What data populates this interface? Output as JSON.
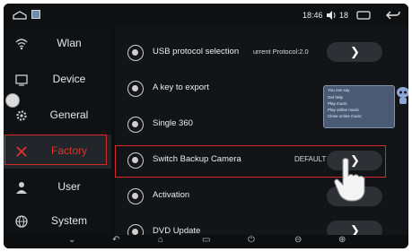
{
  "statusbar": {
    "time": "18:46",
    "volume_level": "18"
  },
  "sidebar": {
    "items": [
      {
        "label": "Wlan",
        "icon": "wifi-icon"
      },
      {
        "label": "Device",
        "icon": "device-icon"
      },
      {
        "label": "General",
        "icon": "gear-icon"
      },
      {
        "label": "Factory",
        "icon": "tools-icon",
        "active": true
      },
      {
        "label": "User",
        "icon": "user-icon"
      },
      {
        "label": "System",
        "icon": "globe-icon"
      }
    ]
  },
  "settings": {
    "rows": [
      {
        "label": "USB protocol selection",
        "value": "urrent Protocol:2.0",
        "control": "arrow"
      },
      {
        "label": "A key to export",
        "control": "none"
      },
      {
        "label": "Single 360",
        "control": "toggle",
        "state": "ON"
      },
      {
        "label": "Switch Backup Camera",
        "value": "DEFAULT",
        "control": "arrow"
      },
      {
        "label": "Activation",
        "control": "pill"
      },
      {
        "label": "DVD Update",
        "control": "arrow"
      }
    ]
  },
  "voice_popup": {
    "title": "You can say",
    "items": [
      "Get help",
      "Play music",
      "Play online music",
      "Close online music"
    ]
  },
  "colors": {
    "accent_red": "#e0312a",
    "toggle_green": "#33c25a",
    "popup_bg": "#4a5a75"
  }
}
